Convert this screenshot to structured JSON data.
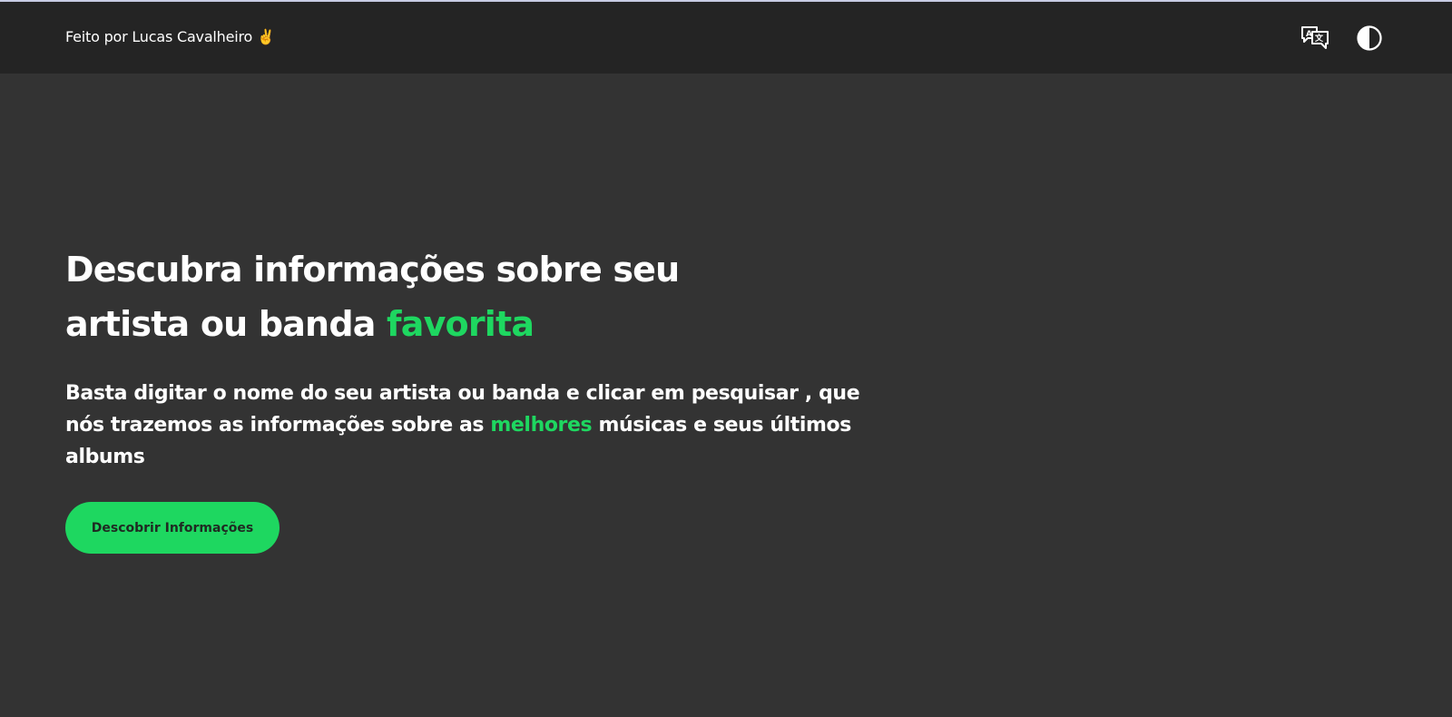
{
  "header": {
    "credit_text": "Feito por Lucas Cavalheiro ✌️",
    "translate_icon": "translate-icon",
    "theme_icon": "contrast-icon"
  },
  "hero": {
    "title_main": "Descubra informações sobre seu artista ou banda ",
    "title_accent": "favorita",
    "description_part1": "Basta digitar o nome do seu artista ou banda e clicar em pesquisar , que nós trazemos as informações sobre as ",
    "description_accent": "melhores",
    "description_part2": " músicas e seus últimos albums",
    "cta_label": "Descobrir Informações"
  },
  "colors": {
    "accent": "#1ed760",
    "background": "#333333",
    "header_background": "#242424"
  }
}
